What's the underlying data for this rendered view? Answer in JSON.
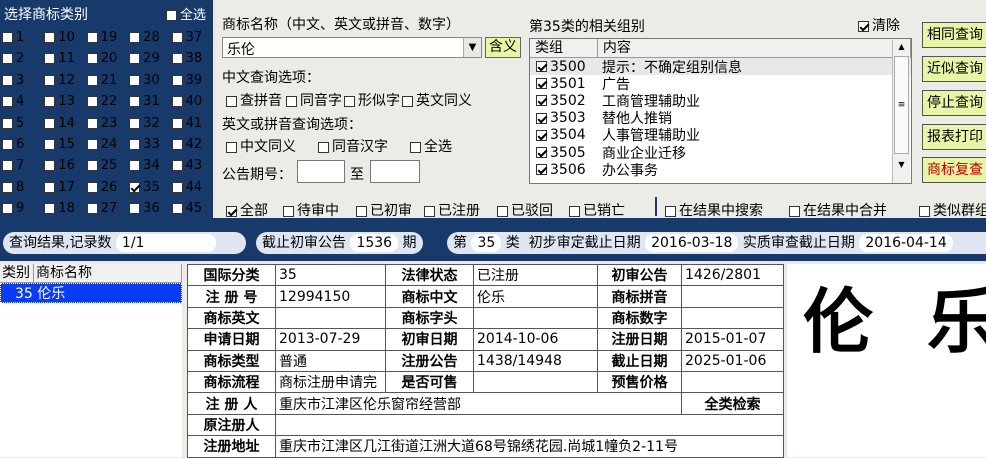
{
  "class_panel": {
    "title": "选择商标类别",
    "select_all": "全选",
    "classes": [
      "1",
      "10",
      "19",
      "28",
      "37",
      "2",
      "11",
      "20",
      "29",
      "38",
      "3",
      "12",
      "21",
      "30",
      "39",
      "4",
      "13",
      "22",
      "31",
      "40",
      "5",
      "14",
      "23",
      "32",
      "41",
      "6",
      "15",
      "24",
      "33",
      "42",
      "7",
      "16",
      "25",
      "34",
      "43",
      "8",
      "17",
      "26",
      "35",
      "44",
      "9",
      "18",
      "27",
      "36",
      "45"
    ],
    "checked": [
      "35"
    ]
  },
  "search": {
    "name_label": "商标名称（中文、英文或拼音、数字）",
    "name_value": "乐伦",
    "meaning_button": "含义",
    "cn_options_label": "中文查询选项：",
    "cn_options": [
      "查拼音",
      "同音字",
      "形似字",
      "英文同义"
    ],
    "en_options_label": "英文或拼音查询选项：",
    "en_options": [
      "中文同义",
      "同音汉字",
      "全选"
    ],
    "issue_label": "公告期号：",
    "issue_to": "至"
  },
  "groups": {
    "title": "第35类的相关组别",
    "clear_label": "清除",
    "headers": [
      "类组",
      "内容"
    ],
    "rows": [
      {
        "code": "3500",
        "content": "提示：不确定组别信息"
      },
      {
        "code": "3501",
        "content": "广告"
      },
      {
        "code": "3502",
        "content": "工商管理辅助业"
      },
      {
        "code": "3503",
        "content": "替他人推销"
      },
      {
        "code": "3504",
        "content": "人事管理辅助业"
      },
      {
        "code": "3505",
        "content": "商业企业迁移"
      },
      {
        "code": "3506",
        "content": "办公事务"
      }
    ]
  },
  "buttons": [
    "相同查询",
    "近似查询",
    "停止查询",
    "报表打印",
    "商标复查"
  ],
  "status_filters": [
    "全部",
    "待审中",
    "已初审",
    "已注册",
    "已驳回",
    "已销亡"
  ],
  "result_filters": [
    "在结果中搜索",
    "在结果中合并",
    "类似群组"
  ],
  "band": {
    "result_label": "查询结果,记录数",
    "result_value": "1/1",
    "cutoff_label": "截止初审公告",
    "cutoff_value": "1536",
    "cutoff_unit": "期",
    "class_prefix": "第",
    "class_value": "35",
    "class_suffix": "类",
    "prelim_label": "初步审定截止日期",
    "prelim_value": "2016-03-18",
    "substantive_label": "实质审查截止日期",
    "substantive_value": "2016-04-14"
  },
  "list": {
    "headers": [
      "类别",
      "商标名称"
    ],
    "row": "35 伦乐"
  },
  "detail": {
    "rows": [
      [
        "国际分类",
        "35",
        "法律状态",
        "已注册",
        "初审公告",
        "1426/2801"
      ],
      [
        "注 册 号",
        "12994150",
        "商标中文",
        "伦乐",
        "商标拼音",
        ""
      ],
      [
        "商标英文",
        "",
        "商标字头",
        "",
        "商标数字",
        ""
      ],
      [
        "申请日期",
        "2013-07-29",
        "初审日期",
        "2014-10-06",
        "注册日期",
        "2015-01-07"
      ],
      [
        "商标类型",
        "普通",
        "注册公告",
        "1438/14948",
        "截止日期",
        "2025-01-06"
      ],
      [
        "商标流程",
        "商标注册申请完",
        "是否可售",
        "",
        "预售价格",
        ""
      ]
    ],
    "registrant_label": "注 册 人",
    "registrant_value": "重庆市江津区伦乐窗帘经营部",
    "all_class_search": "全类检索",
    "orig_registrant_label": "原注册人",
    "orig_registrant_value": "",
    "address_label": "注册地址",
    "address_value": "重庆市江津区几江街道江洲大道68号锦绣花园.尚城1幢负2-11号"
  },
  "trademark_text": "伦乐",
  "colors": {
    "panel": "#183a6b",
    "button": "#e7f5a6",
    "selection": "#0c3cf2",
    "report_text": "#c00000"
  }
}
